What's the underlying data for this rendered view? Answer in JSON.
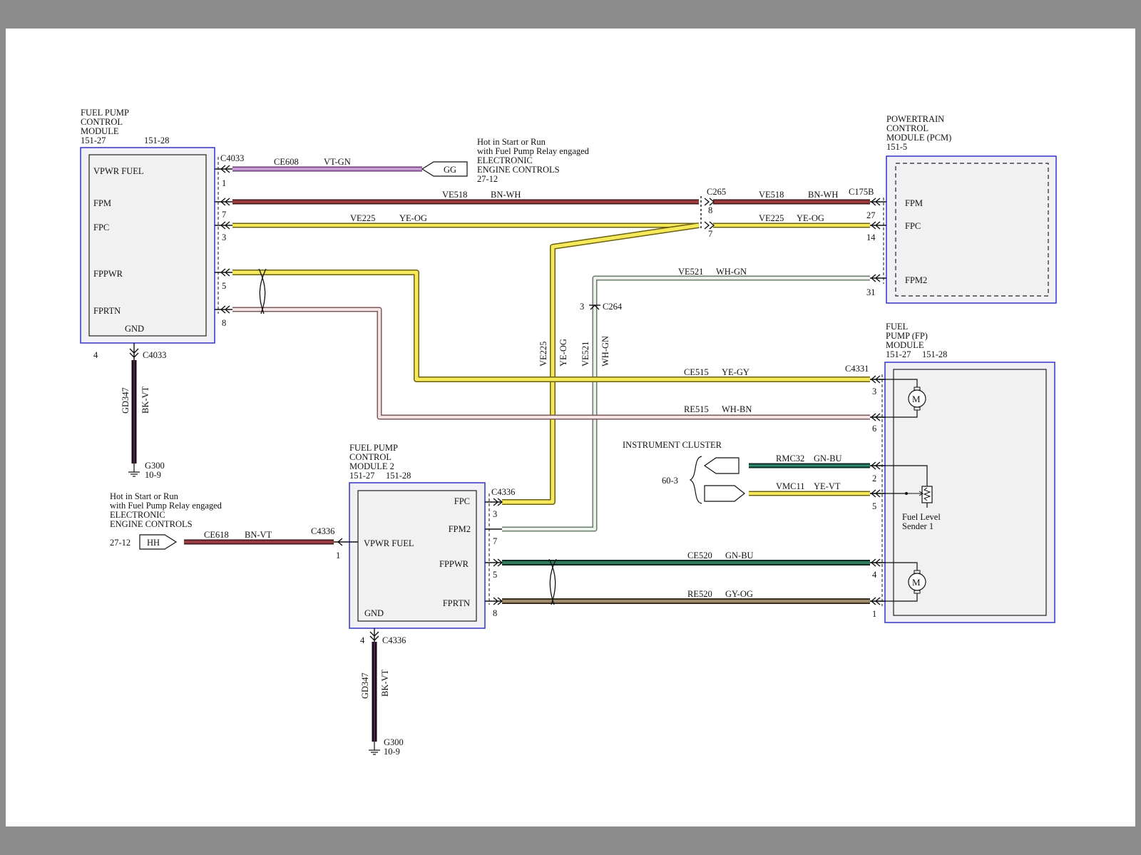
{
  "modules": {
    "fpcm": {
      "name_lines": [
        "FUEL PUMP",
        "CONTROL",
        "MODULE"
      ],
      "refs": [
        "151-27",
        "151-28"
      ],
      "pins": {
        "vpwr": "VPWR FUEL",
        "fpm": "FPM",
        "fpc": "FPC",
        "fppwr": "FPPWR",
        "fprtn": "FPRTN",
        "gnd": "GND"
      }
    },
    "pcm": {
      "name_lines": [
        "POWERTRAIN",
        "CONTROL",
        "MODULE (PCM)"
      ],
      "refs": [
        "151-5"
      ],
      "pins": {
        "fpm": "FPM",
        "fpc": "FPC",
        "fpm2": "FPM2"
      }
    },
    "fp": {
      "name_lines": [
        "FUEL",
        "PUMP (FP)",
        "MODULE"
      ],
      "refs": [
        "151-27",
        "151-28"
      ],
      "sender_lines": [
        "Fuel Level",
        "Sender 1"
      ],
      "motor": "M"
    },
    "fpcm2": {
      "name_lines": [
        "FUEL PUMP",
        "CONTROL",
        "MODULE 2"
      ],
      "refs": [
        "151-27",
        "151-28"
      ],
      "pins": {
        "fpc": "FPC",
        "fpm2": "FPM2",
        "vpwr": "VPWR FUEL",
        "fppwr": "FPPWR",
        "fprtn": "FPRTN",
        "gnd": "GND"
      }
    },
    "cluster": {
      "name": "INSTRUMENT CLUSTER",
      "ref": "60-3"
    }
  },
  "power_notes": {
    "top": {
      "lines": [
        "Hot in Start or Run",
        "with Fuel Pump Relay engaged",
        "ELECTRONIC",
        "ENGINE CONTROLS"
      ],
      "ref": "27-12",
      "tag": "GG"
    },
    "bottom": {
      "lines": [
        "Hot in Start or Run",
        "with Fuel Pump Relay engaged",
        "ELECTRONIC",
        "ENGINE CONTROLS"
      ],
      "ref": "27-12",
      "tag": "HH"
    }
  },
  "connectors": {
    "c4033": "C4033",
    "c265": "C265",
    "c175b": "C175B",
    "c264": "C264",
    "c4331": "C4331",
    "c4336": "C4336"
  },
  "pin_numbers": {
    "fpcm_vpwr": "1",
    "fpcm_fpm": "7",
    "fpcm_fpc": "3",
    "fpcm_fppwr": "5",
    "fpcm_fprtn": "8",
    "fpcm_gnd": "4",
    "c265_a": "8",
    "c265_b": "7",
    "pcm_fpm": "27",
    "pcm_fpc": "14",
    "pcm_fpm2": "31",
    "c264": "3",
    "fp_1": "3",
    "fp_2": "6",
    "fp_3": "2",
    "fp_4": "5",
    "fp_5": "4",
    "fp_6": "1",
    "fpcm2_fpc": "3",
    "fpcm2_fpm2": "7",
    "fpcm2_vpwr": "1",
    "fpcm2_fppwr": "5",
    "fpcm2_fprtn": "8",
    "fpcm2_gnd": "4"
  },
  "wires": {
    "ce608": {
      "circuit": "CE608",
      "color": "VT-GN"
    },
    "ve518a": {
      "circuit": "VE518",
      "color": "BN-WH"
    },
    "ve225a": {
      "circuit": "VE225",
      "color": "YE-OG"
    },
    "ve518b": {
      "circuit": "VE518",
      "color": "BN-WH"
    },
    "ve225b": {
      "circuit": "VE225",
      "color": "YE-OG"
    },
    "ve521": {
      "circuit": "VE521",
      "color": "WH-GN"
    },
    "ve225v": {
      "circuit": "VE225",
      "color": "YE-OG"
    },
    "ve521v": {
      "circuit": "VE521",
      "color": "WH-GN"
    },
    "ce515": {
      "circuit": "CE515",
      "color": "YE-GY"
    },
    "re515": {
      "circuit": "RE515",
      "color": "WH-BN"
    },
    "rmc32": {
      "circuit": "RMC32",
      "color": "GN-BU"
    },
    "vmc11": {
      "circuit": "VMC11",
      "color": "YE-VT"
    },
    "ce618": {
      "circuit": "CE618",
      "color": "BN-VT"
    },
    "ce520": {
      "circuit": "CE520",
      "color": "GN-BU"
    },
    "re520": {
      "circuit": "RE520",
      "color": "GY-OG"
    },
    "gd347a": {
      "circuit": "GD347",
      "color": "BK-VT"
    },
    "gd347b": {
      "circuit": "GD347",
      "color": "BK-VT"
    }
  },
  "grounds": {
    "g1": {
      "name": "G300",
      "ref": "10-9"
    },
    "g2": {
      "name": "G300",
      "ref": "10-9"
    }
  },
  "colors": {
    "module_border": "#3333cc",
    "module_fill": "#f0f0f0",
    "violet_green": "#b87cc8",
    "brown_white": "#8e3a3a",
    "yellow": "#f2e64a",
    "white_green": "#c4d4c4",
    "white_brown": "#d8b0b0",
    "green_blue": "#2a6a50",
    "brown_violet": "#8e3a44",
    "gray_orange": "#8f8068",
    "black_violet": "#1c0e1c"
  }
}
